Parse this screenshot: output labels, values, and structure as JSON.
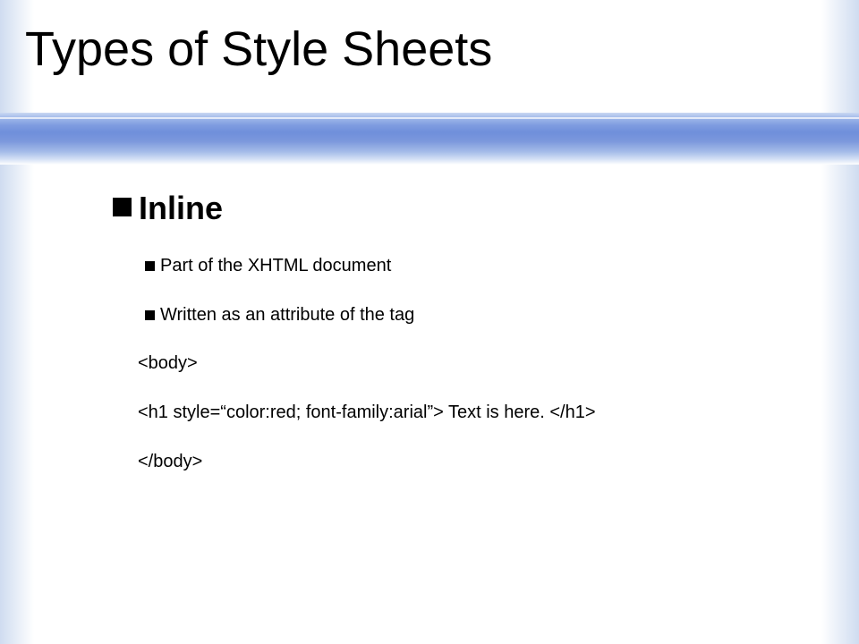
{
  "slide": {
    "title": "Types of Style Sheets",
    "heading": "Inline",
    "bullets": [
      "Part of the XHTML document",
      "Written as an attribute of the tag"
    ],
    "code": [
      "<body>",
      "<h1 style=“color:red; font-family:arial”> Text is here. </h1>",
      "</body>"
    ]
  },
  "colors": {
    "title_band": "#7f9ce0",
    "text": "#000000",
    "background": "#ffffff"
  }
}
